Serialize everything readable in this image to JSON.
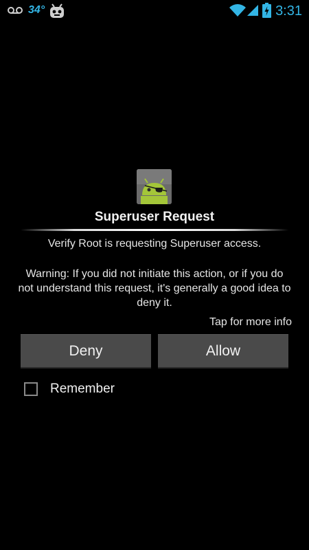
{
  "status_bar": {
    "temperature": "34°",
    "time": "3:31",
    "icons": [
      "voicemail-icon",
      "cyanogen-mascot-icon",
      "wifi-icon",
      "signal-icon",
      "battery-charging-icon"
    ],
    "accent_color": "#33b5e5"
  },
  "dialog": {
    "icon": "superuser-android-pirate-icon",
    "title": "Superuser Request",
    "request": "Verify Root is requesting Superuser access.",
    "warning": "Warning: If you did not initiate this action, or if you do not understand this request, it's generally a good idea to deny it.",
    "more_info": "Tap for more info",
    "deny_label": "Deny",
    "allow_label": "Allow",
    "remember_label": "Remember",
    "remember_checked": false
  }
}
